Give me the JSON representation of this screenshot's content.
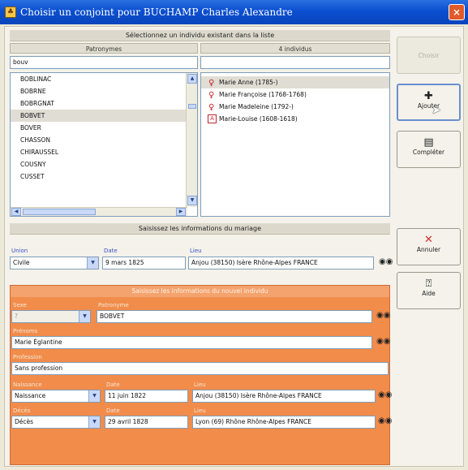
{
  "window": {
    "title": "Choisir un conjoint pour BUCHAMP Charles Alexandre",
    "close_glyph": "×",
    "app_icon_glyph": "♣"
  },
  "select_section": {
    "header": "Sélectionnez un individu existant dans la liste",
    "surnames_header": "Patronymes",
    "individuals_header": "4 individus",
    "surname_filter_value": "bouv",
    "individual_filter_value": "",
    "surnames": [
      "BOBLINAC",
      "BOBRNE",
      "BOBRGNAT",
      "BOBVET",
      "BOVER",
      "CHASSON",
      "CHIRAUSSEL",
      "COUSNY",
      "CUSSET"
    ],
    "selected_surname": "BOBVET",
    "individuals": [
      {
        "name": "Marie Anne (1785-)",
        "icon": "female-icon",
        "glyph": "♀"
      },
      {
        "name": "Marie Françoise (1768-1768)",
        "icon": "female-icon",
        "glyph": "♀"
      },
      {
        "name": "Marie Madeleine (1792-)",
        "icon": "female-icon",
        "glyph": "♀"
      },
      {
        "name": "Marie-Louise (1608-1618)",
        "icon": "portrait-icon",
        "glyph": "A"
      }
    ]
  },
  "marriage_section": {
    "header": "Saisissez les informations du mariage",
    "union_label": "Union",
    "union_value": "Civile",
    "date_label": "Date",
    "date_value": "9 mars 1825",
    "place_label": "Lieu",
    "place_value": "Anjou (38150) Isère Rhône-Alpes FRANCE"
  },
  "new_person_section": {
    "header": "Saisissez les informations du nouvel individu",
    "sex_label": "Sexe",
    "sex_value": "?",
    "surname_label": "Patronyme",
    "surname_value": "BOBVET",
    "given_names_label": "Prénoms",
    "given_names_value": "Marie Églantine",
    "profession_label": "Profession",
    "profession_value": "Sans profession",
    "birth_label": "Naissance",
    "birth_type": "Naissance",
    "birth_date_label": "Date",
    "birth_date": "11 juin 1822",
    "birth_place_label": "Lieu",
    "birth_place": "Anjou (38150) Isère Rhône-Alpes FRANCE",
    "death_label": "Décès",
    "death_type": "Décès",
    "death_date_label": "Date",
    "death_date": "29 avril 1828",
    "death_place_label": "Lieu",
    "death_place": "Lyon (69) Rhône Rhône-Alpes FRANCE"
  },
  "actions": {
    "choose": "Choisir",
    "add": "Ajouter",
    "add_glyph": "✚",
    "complete": "Compléter",
    "complete_glyph": "▤",
    "cancel": "Annuler",
    "cancel_glyph": "✕",
    "help": "Aide",
    "help_glyph": "⍰"
  },
  "colors": {
    "title_bar": "#0b4fd0",
    "new_person_panel": "#f28c4b",
    "label_blue": "#3a50c8",
    "female_red": "#c2242b"
  }
}
